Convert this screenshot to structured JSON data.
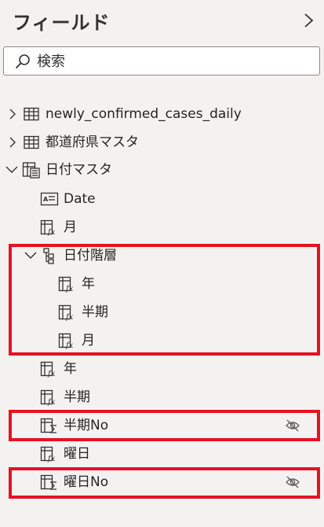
{
  "header": {
    "title": "フィールド"
  },
  "search": {
    "placeholder": "検索",
    "value": ""
  },
  "tree": {
    "items": [
      {
        "label": "newly_confirmed_cases_daily",
        "icon": "table-icon",
        "expanded": false
      },
      {
        "label": "都道府県マスタ",
        "icon": "table-icon",
        "expanded": false
      },
      {
        "label": "日付マスタ",
        "icon": "calculated-table-icon",
        "expanded": true
      },
      {
        "label": "Date",
        "icon": "date-field-icon"
      },
      {
        "label": "月",
        "icon": "calculated-column-icon"
      },
      {
        "label": "日付階層",
        "icon": "hierarchy-icon",
        "expanded": true
      },
      {
        "label": "年",
        "icon": "calculated-column-icon"
      },
      {
        "label": "半期",
        "icon": "calculated-column-icon"
      },
      {
        "label": "月",
        "icon": "calculated-column-icon"
      },
      {
        "label": "年",
        "icon": "calculated-column-icon"
      },
      {
        "label": "半期",
        "icon": "calculated-column-icon"
      },
      {
        "label": "半期No",
        "icon": "sum-column-icon",
        "hidden": true
      },
      {
        "label": "曜日",
        "icon": "calculated-column-icon"
      },
      {
        "label": "曜日No",
        "icon": "sum-column-icon",
        "hidden": true
      }
    ]
  },
  "colors": {
    "highlight": "#e81123",
    "background": "#f3f2f1",
    "text": "#252423"
  }
}
